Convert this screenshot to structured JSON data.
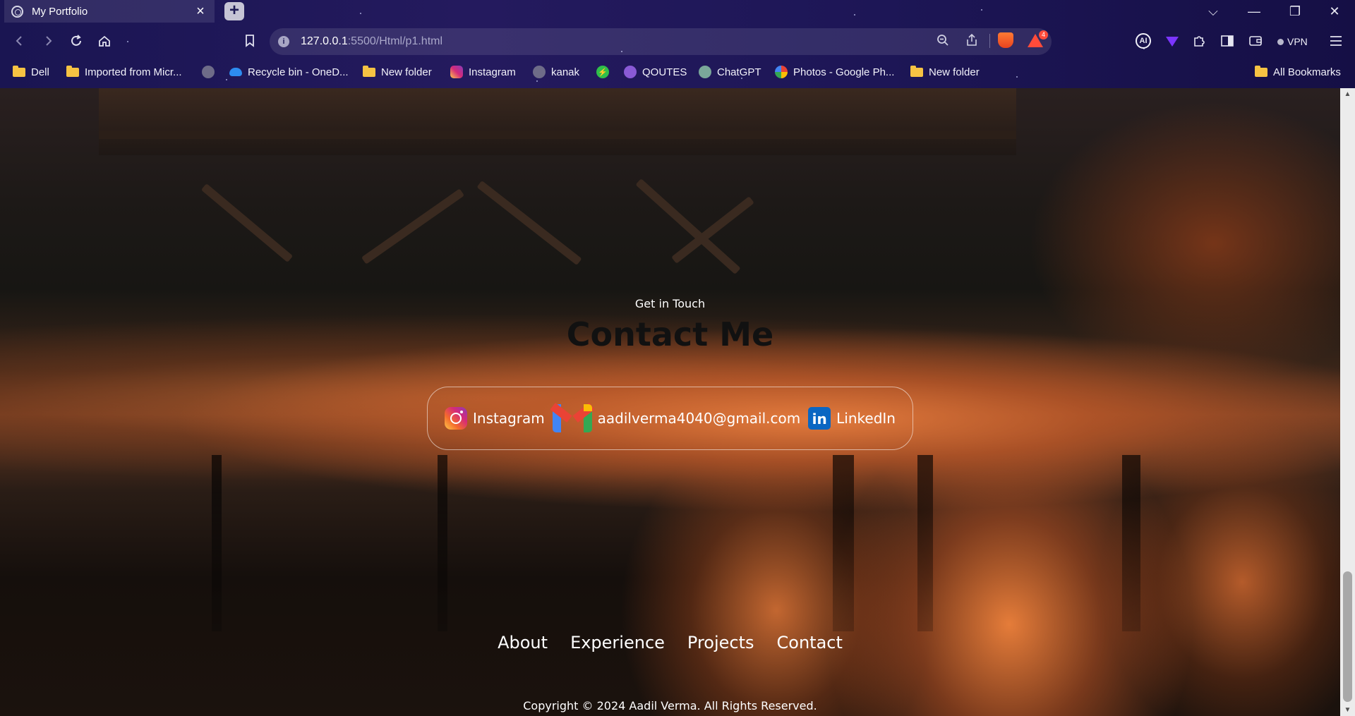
{
  "browser": {
    "tab_title": "My Portfolio",
    "tab_close": "×",
    "new_tab": "+",
    "url_host": "127.0.0.1",
    "url_path": ":5500/Html/p1.html",
    "url_info": "i",
    "rewards_count": "4",
    "ext_ai": "AI",
    "vpn_label": "VPN",
    "window_controls": {
      "tabs_menu": "⌵",
      "minimize": "—",
      "restore": "❐",
      "close": "✕"
    }
  },
  "bookmarks": [
    {
      "label": "Dell",
      "icon": "folder-icon"
    },
    {
      "label": "Imported from Micr...",
      "icon": "folder-icon"
    },
    {
      "label": "",
      "icon": "globe-icon"
    },
    {
      "label": "Recycle bin - OneD...",
      "icon": "onedrive-icon"
    },
    {
      "label": "New folder",
      "icon": "folder-icon"
    },
    {
      "label": "Instagram",
      "icon": "instagram-icon"
    },
    {
      "label": "kanak",
      "icon": "globe-icon"
    },
    {
      "label": "",
      "icon": "bolt-icon"
    },
    {
      "label": "QOUTES",
      "icon": "cat-icon"
    },
    {
      "label": "ChatGPT",
      "icon": "chatgpt-icon"
    },
    {
      "label": "Photos - Google Ph...",
      "icon": "pinwheel-icon"
    },
    {
      "label": "New folder",
      "icon": "folder-icon"
    }
  ],
  "all_bookmarks": "All Bookmarks",
  "contact": {
    "subtitle": "Get in Touch",
    "title": "Contact Me",
    "instagram": "Instagram",
    "email": "aadilverma4040@gmail.com",
    "linkedin": "LinkedIn",
    "linkedin_glyph": "in"
  },
  "footer": {
    "links": [
      "About",
      "Experience",
      "Projects",
      "Contact"
    ],
    "copyright": "Copyright © 2024 Aadil Verma. All Rights Reserved."
  },
  "colors": {
    "chrome_bg": "#1d1656",
    "accent_orange": "#e77d3e",
    "title_text": "#111111",
    "body_text": "#ffffff"
  }
}
